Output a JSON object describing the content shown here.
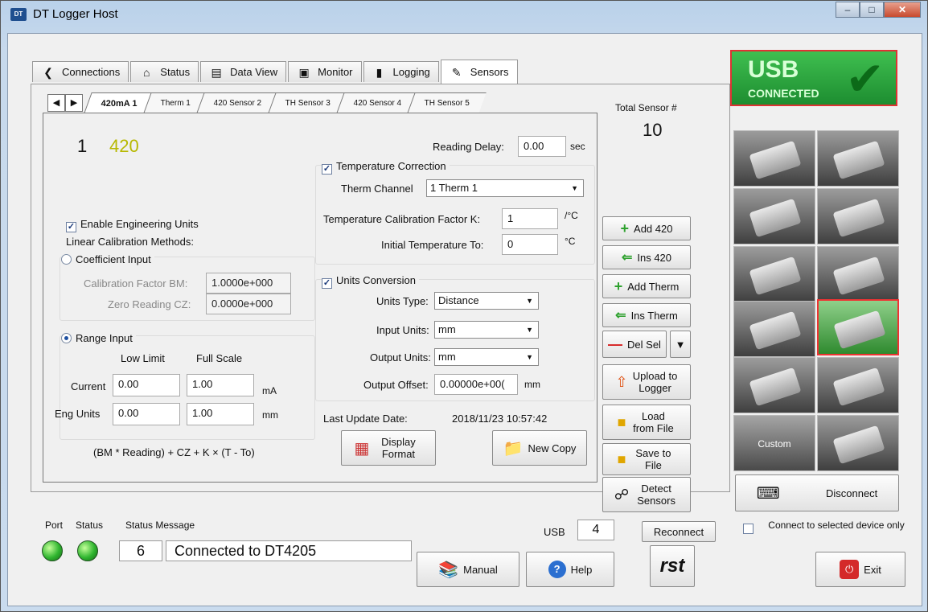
{
  "window": {
    "title": "DT Logger Host",
    "icon_text": "DT"
  },
  "main_tabs": [
    {
      "label": "Connections",
      "icon": "share-icon"
    },
    {
      "label": "Status",
      "icon": "home-icon"
    },
    {
      "label": "Data View",
      "icon": "table-icon"
    },
    {
      "label": "Monitor",
      "icon": "monitor-icon"
    },
    {
      "label": "Logging",
      "icon": "logging-icon"
    },
    {
      "label": "Sensors",
      "icon": "sensors-icon"
    }
  ],
  "sensor_tabs": [
    "420mA 1",
    "Therm 1",
    "420 Sensor 2",
    "TH Sensor 3",
    "420 Sensor 4",
    "TH Sensor 5"
  ],
  "sensor": {
    "number": "1",
    "type": "420",
    "reading_delay_label": "Reading Delay:",
    "reading_delay_value": "0.00",
    "reading_delay_unit": "sec",
    "enable_eng_units": "Enable Engineering Units",
    "linear_cal_methods": "Linear Calibration Methods:",
    "coefficient_input": "Coefficient Input",
    "cal_factor_label": "Calibration Factor BM:",
    "cal_factor_value": "1.0000e+000",
    "zero_reading_label": "Zero Reading CZ:",
    "zero_reading_value": "0.0000e+000",
    "range_input": "Range Input",
    "low_limit": "Low Limit",
    "full_scale": "Full Scale",
    "current_label": "Current",
    "current_low": "0.00",
    "current_full": "1.00",
    "current_unit": "mA",
    "eng_units_label": "Eng Units",
    "eng_low": "0.00",
    "eng_full": "1.00",
    "eng_unit": "mm",
    "formula": "(BM * Reading) + CZ + K × (T - To)",
    "temp_correction": "Temperature Correction",
    "therm_channel_label": "Therm Channel",
    "therm_channel_value": "1 Therm 1",
    "temp_cal_factor_label": "Temperature Calibration Factor K:",
    "temp_cal_factor_value": "1",
    "temp_cal_factor_unit": "/°C",
    "initial_temp_label": "Initial Temperature To:",
    "initial_temp_value": "0",
    "initial_temp_unit": "°C",
    "units_conversion": "Units Conversion",
    "units_type_label": "Units Type:",
    "units_type_value": "Distance",
    "input_units_label": "Input Units:",
    "input_units_value": "mm",
    "output_units_label": "Output Units:",
    "output_units_value": "mm",
    "output_offset_label": "Output Offset:",
    "output_offset_value": "0.00000e+00(",
    "output_offset_unit": "mm",
    "last_update_label": "Last Update Date:",
    "last_update_value": "2018/11/23 10:57:42",
    "display_format": "Display Format",
    "new_copy": "New Copy"
  },
  "action_buttons": {
    "add_420": "Add 420",
    "ins_420": "Ins 420",
    "add_therm": "Add Therm",
    "ins_therm": "Ins Therm",
    "del_sel": "Del Sel",
    "upload": "Upload to Logger",
    "load": "Load from File",
    "save": "Save to File",
    "detect": "Detect Sensors"
  },
  "total_sensor_label": "Total Sensor #",
  "total_sensor_value": "10",
  "usb_badge": {
    "line1": "USB",
    "line2": "CONNECTED"
  },
  "device_thumbs": [
    "device-1",
    "device-2",
    "device-3",
    "device-4",
    "device-5",
    "device-6",
    "device-7",
    "device-8-selected",
    "device-9",
    "device-10"
  ],
  "custom_label": "Custom",
  "disconnect": "Disconnect",
  "connect_selected": "Connect to selected device only",
  "status": {
    "port_label": "Port",
    "status_label": "Status",
    "status_message_label": "Status Message",
    "port_number": "6",
    "message": "Connected to DT4205",
    "usb_label": "USB",
    "usb_value": "4",
    "reconnect": "Reconnect"
  },
  "bottom_buttons": {
    "manual": "Manual",
    "help": "Help",
    "exit": "Exit",
    "logo": "rst"
  },
  "colors": {
    "accent_green": "#2ea12e",
    "usb_green": "#1d8d30",
    "sensor_type": "#b7b800"
  }
}
